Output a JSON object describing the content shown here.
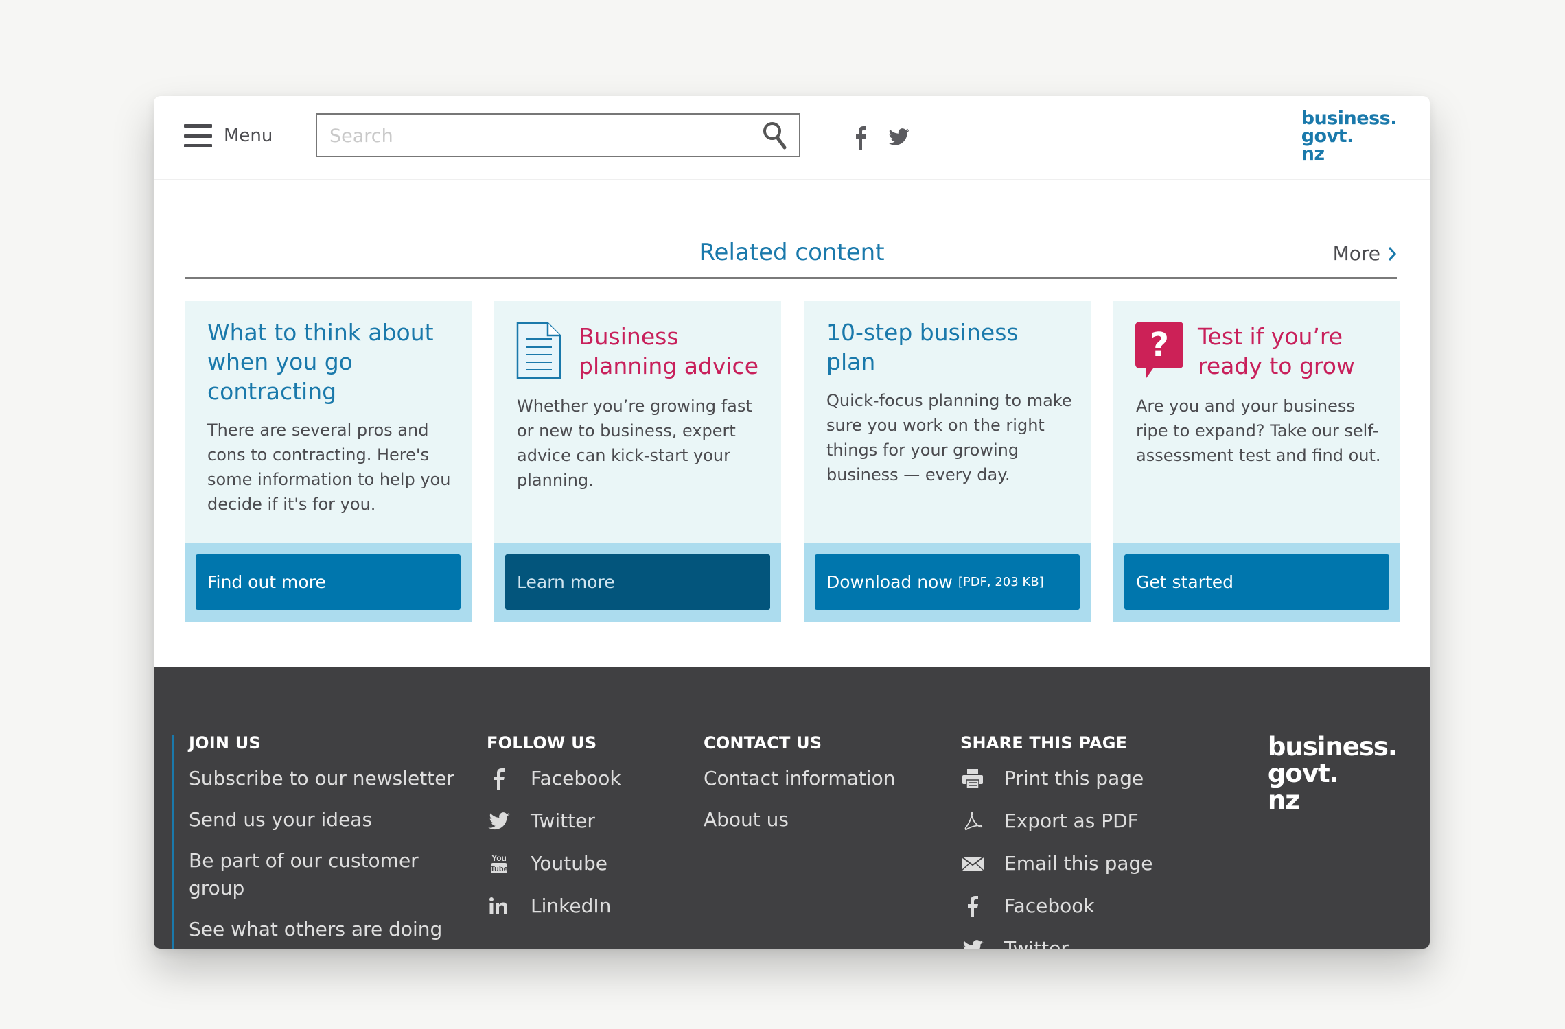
{
  "header": {
    "menu_label": "Menu",
    "search_placeholder": "Search",
    "search_value": "",
    "social_icons": [
      "facebook-icon",
      "twitter-icon"
    ],
    "logo_lines": [
      "business.",
      "govt.",
      "nz"
    ]
  },
  "related": {
    "title": "Related content",
    "more_label": "More"
  },
  "cards": [
    {
      "title": "What to think about when you go contracting",
      "description": "There are several pros and cons to contracting. Here's some information to help you decide if it's for you.",
      "button_label": "Find out more",
      "button_note": "",
      "icon": "",
      "title_color": "#1a79ab"
    },
    {
      "title": "Business planning advice",
      "description": "Whether you’re growing fast or new to business, expert advice can kick-start your planning.",
      "button_label": "Learn more",
      "button_note": "",
      "icon": "document-icon",
      "title_color": "#c8205b"
    },
    {
      "title": "10-step business plan",
      "description": "Quick-focus planning to make sure you work on the right things for your growing business — every day.",
      "button_label": "Download now",
      "button_note": "[PDF, 203 KB]",
      "icon": "",
      "title_color": "#1a79ab"
    },
    {
      "title": "Test if you’re ready to grow",
      "description": "Are you and your business ripe to expand? Take our self-assessment test and find out.",
      "button_label": "Get started",
      "button_note": "",
      "icon": "question-bubble-icon",
      "title_color": "#c8205b"
    }
  ],
  "footer": {
    "join_us": {
      "heading": "JOIN US",
      "items": [
        "Subscribe to our newsletter",
        "Send us your ideas",
        "Be part of our customer group",
        "See what others are doing"
      ]
    },
    "follow_us": {
      "heading": "FOLLOW US",
      "items": [
        {
          "label": "Facebook",
          "icon": "facebook-icon"
        },
        {
          "label": "Twitter",
          "icon": "twitter-icon"
        },
        {
          "label": "Youtube",
          "icon": "youtube-icon"
        },
        {
          "label": "LinkedIn",
          "icon": "linkedin-icon"
        }
      ]
    },
    "contact_us": {
      "heading": "CONTACT US",
      "items": [
        "Contact information",
        "About us"
      ]
    },
    "share": {
      "heading": "SHARE THIS PAGE",
      "items": [
        {
          "label": "Print this page",
          "icon": "printer-icon"
        },
        {
          "label": "Export as PDF",
          "icon": "pdf-icon"
        },
        {
          "label": "Email this page",
          "icon": "email-icon"
        },
        {
          "label": "Facebook",
          "icon": "facebook-icon"
        },
        {
          "label": "Twitter",
          "icon": "twitter-icon"
        }
      ]
    },
    "logo_lines": [
      "business.",
      "govt.",
      "nz"
    ]
  },
  "colors": {
    "brand_blue": "#1a79ab",
    "button_blue": "#0076ad",
    "button_dark": "#03557c",
    "accent_pink": "#c8205b",
    "card_bg": "#eaf6f7",
    "card_footer_bg": "#acdcee",
    "footer_bg": "#404042"
  }
}
